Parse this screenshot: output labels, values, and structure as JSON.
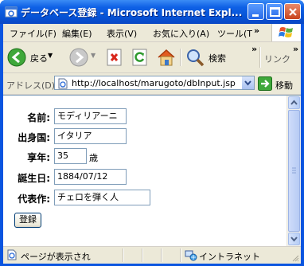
{
  "window": {
    "title": "データベース登録 - Microsoft Internet Expl..."
  },
  "menu": {
    "items": [
      "ファイル(F)",
      "編集(E)",
      "表示(V)",
      "お気に入り(A)",
      "ツール(T"
    ],
    "overflow": "»"
  },
  "toolbar": {
    "back_label": "戻る",
    "search_label": "検索",
    "overflow": "»",
    "links_label": "リンク"
  },
  "address": {
    "label": "アドレス(D)",
    "url": "http://localhost/marugoto/dbInput.jsp",
    "go_label": "移動"
  },
  "form": {
    "name_label": "名前:",
    "name_value": "モディリアーニ",
    "birthplace_label": "出身国:",
    "birthplace_value": "イタリア",
    "age_label": "享年:",
    "age_value": "35",
    "age_unit": "歳",
    "birthday_label": "誕生日:",
    "birthday_value": "1884/07/12",
    "work_label": "代表作:",
    "work_value": "チェロを弾く人",
    "submit_label": "登録"
  },
  "status": {
    "text": "ページが表示され",
    "zone": "イントラネット"
  },
  "colors": {
    "titlebar": "#0553d6",
    "chrome": "#ece9d8",
    "input_border": "#7f9db9"
  }
}
